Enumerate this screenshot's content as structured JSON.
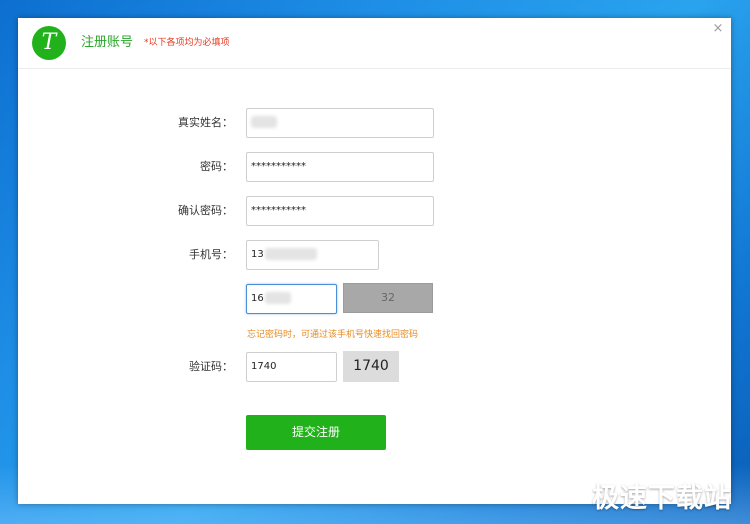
{
  "dialog": {
    "logo_letter": "T",
    "title": "注册账号",
    "required_note": "*以下各项均为必填项",
    "close_icon": "×"
  },
  "form": {
    "real_name": {
      "label": "真实姓名："
    },
    "password": {
      "label": "密码：",
      "value": "***********"
    },
    "confirm_password": {
      "label": "确认密码：",
      "value": "***********"
    },
    "phone": {
      "label": "手机号：",
      "value_prefix": "13"
    },
    "sms_code": {
      "value_prefix": "16",
      "button_label": "32"
    },
    "hint": "忘记密码时，可通过该手机号快速找回密码",
    "captcha": {
      "label": "验证码：",
      "value": "1740",
      "image_text": "1740"
    },
    "submit_label": "提交注册"
  },
  "watermark": "极速下载站",
  "colors": {
    "brand_green": "#21b21b",
    "title_green": "#2aa62a",
    "note_red": "#e8361f",
    "hint_orange": "#e68a1e",
    "disabled_gray": "#a8a8a8",
    "desktop_blue": "#1e8ee6"
  }
}
